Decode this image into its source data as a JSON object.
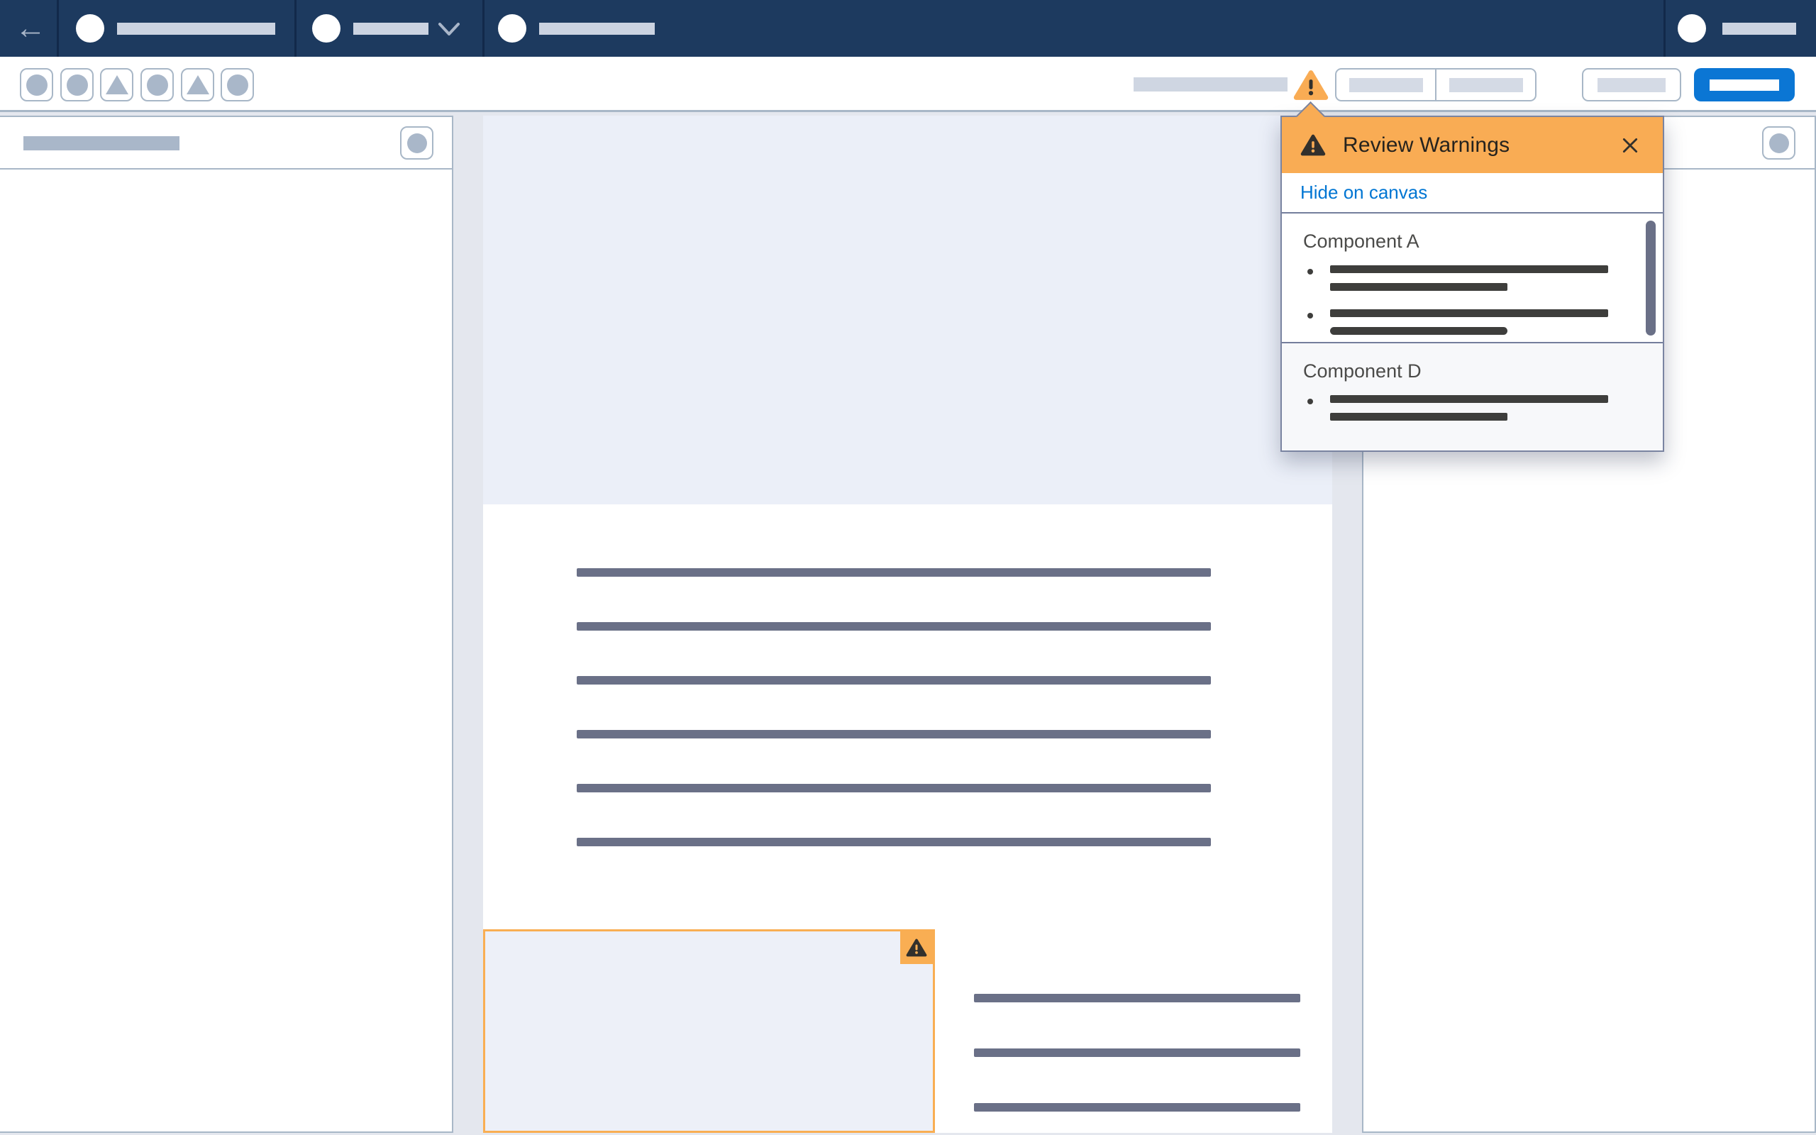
{
  "header": {
    "back_icon": "←",
    "nav_sections": 3,
    "chevron_icon": "chevron-down",
    "user_menu": "avatar-with-label"
  },
  "toolbar": {
    "left_icon_buttons": [
      "circle",
      "circle",
      "triangle",
      "circle",
      "triangle",
      "circle"
    ],
    "warning_icon": "warning-triangle",
    "segmented_buttons": 2,
    "outline_buttons": 1,
    "primary_button": "filled-blue"
  },
  "warnings_popover": {
    "warning_icon": "warning-triangle",
    "title": "Review Warnings",
    "close_icon": "×",
    "hide_link": "Hide on canvas",
    "sections": [
      {
        "title": "Component A",
        "bullet_count": 2,
        "scrollbar": true
      },
      {
        "title": "Component D",
        "bullet_count": 1,
        "scrollbar": false
      }
    ]
  },
  "canvas": {
    "hero_placeholder": "image-skeleton",
    "body_line_count": 6,
    "flagged_component": {
      "badge_icon": "warning-triangle",
      "side_line_count": 3
    }
  },
  "colors": {
    "header_navy": "#1D3A5F",
    "header_divider": "#12294A",
    "warning_orange": "#F9AC54",
    "warning_border": "#F9AE53",
    "primary_blue": "#0B76D4",
    "link_blue": "#0176D3",
    "slate_line": "#6A7087",
    "dark_line": "#3E3E3C",
    "panel_border": "#A8B7C7",
    "skeleton_gray": "#A9B7C9",
    "hero_fill": "#EBEFF8",
    "workspace_bg": "#E4E7EE"
  }
}
